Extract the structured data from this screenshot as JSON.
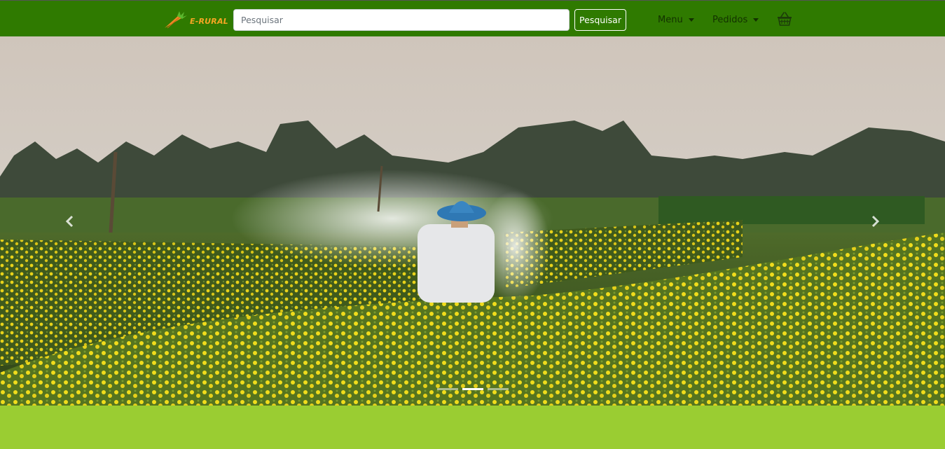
{
  "navbar": {
    "brand": {
      "text": "E-RURAL",
      "logo": "carrot-logo-icon"
    },
    "search": {
      "placeholder": "Pesquisar",
      "value": "",
      "button_label": "Pesquisar"
    },
    "menu_label": "Menu",
    "orders_label": "Pedidos",
    "cart_icon": "basket-icon"
  },
  "carousel": {
    "slide_count": 3,
    "active_index": 1,
    "prev_icon": "chevron-left-icon",
    "next_icon": "chevron-right-icon"
  },
  "colors": {
    "navbar_bg": "#2f7a00",
    "page_bg": "#9acd32",
    "brand_accent": "#f6a623"
  }
}
